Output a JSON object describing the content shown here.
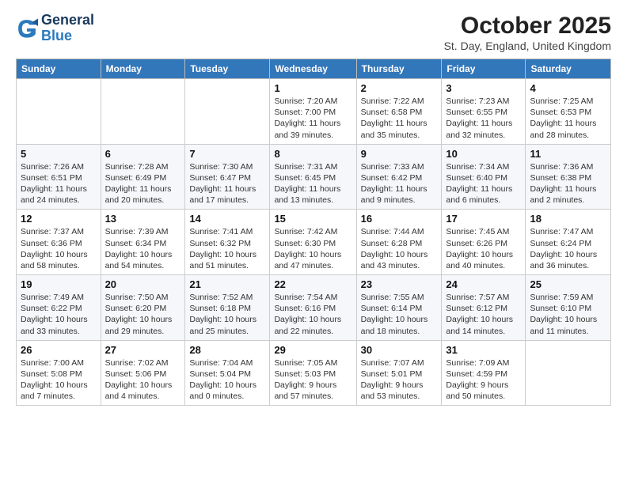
{
  "header": {
    "logo_line1": "General",
    "logo_line2": "Blue",
    "title": "October 2025",
    "location": "St. Day, England, United Kingdom"
  },
  "weekdays": [
    "Sunday",
    "Monday",
    "Tuesday",
    "Wednesday",
    "Thursday",
    "Friday",
    "Saturday"
  ],
  "weeks": [
    [
      {
        "day": "",
        "info": ""
      },
      {
        "day": "",
        "info": ""
      },
      {
        "day": "",
        "info": ""
      },
      {
        "day": "1",
        "info": "Sunrise: 7:20 AM\nSunset: 7:00 PM\nDaylight: 11 hours and 39 minutes."
      },
      {
        "day": "2",
        "info": "Sunrise: 7:22 AM\nSunset: 6:58 PM\nDaylight: 11 hours and 35 minutes."
      },
      {
        "day": "3",
        "info": "Sunrise: 7:23 AM\nSunset: 6:55 PM\nDaylight: 11 hours and 32 minutes."
      },
      {
        "day": "4",
        "info": "Sunrise: 7:25 AM\nSunset: 6:53 PM\nDaylight: 11 hours and 28 minutes."
      }
    ],
    [
      {
        "day": "5",
        "info": "Sunrise: 7:26 AM\nSunset: 6:51 PM\nDaylight: 11 hours and 24 minutes."
      },
      {
        "day": "6",
        "info": "Sunrise: 7:28 AM\nSunset: 6:49 PM\nDaylight: 11 hours and 20 minutes."
      },
      {
        "day": "7",
        "info": "Sunrise: 7:30 AM\nSunset: 6:47 PM\nDaylight: 11 hours and 17 minutes."
      },
      {
        "day": "8",
        "info": "Sunrise: 7:31 AM\nSunset: 6:45 PM\nDaylight: 11 hours and 13 minutes."
      },
      {
        "day": "9",
        "info": "Sunrise: 7:33 AM\nSunset: 6:42 PM\nDaylight: 11 hours and 9 minutes."
      },
      {
        "day": "10",
        "info": "Sunrise: 7:34 AM\nSunset: 6:40 PM\nDaylight: 11 hours and 6 minutes."
      },
      {
        "day": "11",
        "info": "Sunrise: 7:36 AM\nSunset: 6:38 PM\nDaylight: 11 hours and 2 minutes."
      }
    ],
    [
      {
        "day": "12",
        "info": "Sunrise: 7:37 AM\nSunset: 6:36 PM\nDaylight: 10 hours and 58 minutes."
      },
      {
        "day": "13",
        "info": "Sunrise: 7:39 AM\nSunset: 6:34 PM\nDaylight: 10 hours and 54 minutes."
      },
      {
        "day": "14",
        "info": "Sunrise: 7:41 AM\nSunset: 6:32 PM\nDaylight: 10 hours and 51 minutes."
      },
      {
        "day": "15",
        "info": "Sunrise: 7:42 AM\nSunset: 6:30 PM\nDaylight: 10 hours and 47 minutes."
      },
      {
        "day": "16",
        "info": "Sunrise: 7:44 AM\nSunset: 6:28 PM\nDaylight: 10 hours and 43 minutes."
      },
      {
        "day": "17",
        "info": "Sunrise: 7:45 AM\nSunset: 6:26 PM\nDaylight: 10 hours and 40 minutes."
      },
      {
        "day": "18",
        "info": "Sunrise: 7:47 AM\nSunset: 6:24 PM\nDaylight: 10 hours and 36 minutes."
      }
    ],
    [
      {
        "day": "19",
        "info": "Sunrise: 7:49 AM\nSunset: 6:22 PM\nDaylight: 10 hours and 33 minutes."
      },
      {
        "day": "20",
        "info": "Sunrise: 7:50 AM\nSunset: 6:20 PM\nDaylight: 10 hours and 29 minutes."
      },
      {
        "day": "21",
        "info": "Sunrise: 7:52 AM\nSunset: 6:18 PM\nDaylight: 10 hours and 25 minutes."
      },
      {
        "day": "22",
        "info": "Sunrise: 7:54 AM\nSunset: 6:16 PM\nDaylight: 10 hours and 22 minutes."
      },
      {
        "day": "23",
        "info": "Sunrise: 7:55 AM\nSunset: 6:14 PM\nDaylight: 10 hours and 18 minutes."
      },
      {
        "day": "24",
        "info": "Sunrise: 7:57 AM\nSunset: 6:12 PM\nDaylight: 10 hours and 14 minutes."
      },
      {
        "day": "25",
        "info": "Sunrise: 7:59 AM\nSunset: 6:10 PM\nDaylight: 10 hours and 11 minutes."
      }
    ],
    [
      {
        "day": "26",
        "info": "Sunrise: 7:00 AM\nSunset: 5:08 PM\nDaylight: 10 hours and 7 minutes."
      },
      {
        "day": "27",
        "info": "Sunrise: 7:02 AM\nSunset: 5:06 PM\nDaylight: 10 hours and 4 minutes."
      },
      {
        "day": "28",
        "info": "Sunrise: 7:04 AM\nSunset: 5:04 PM\nDaylight: 10 hours and 0 minutes."
      },
      {
        "day": "29",
        "info": "Sunrise: 7:05 AM\nSunset: 5:03 PM\nDaylight: 9 hours and 57 minutes."
      },
      {
        "day": "30",
        "info": "Sunrise: 7:07 AM\nSunset: 5:01 PM\nDaylight: 9 hours and 53 minutes."
      },
      {
        "day": "31",
        "info": "Sunrise: 7:09 AM\nSunset: 4:59 PM\nDaylight: 9 hours and 50 minutes."
      },
      {
        "day": "",
        "info": ""
      }
    ]
  ]
}
